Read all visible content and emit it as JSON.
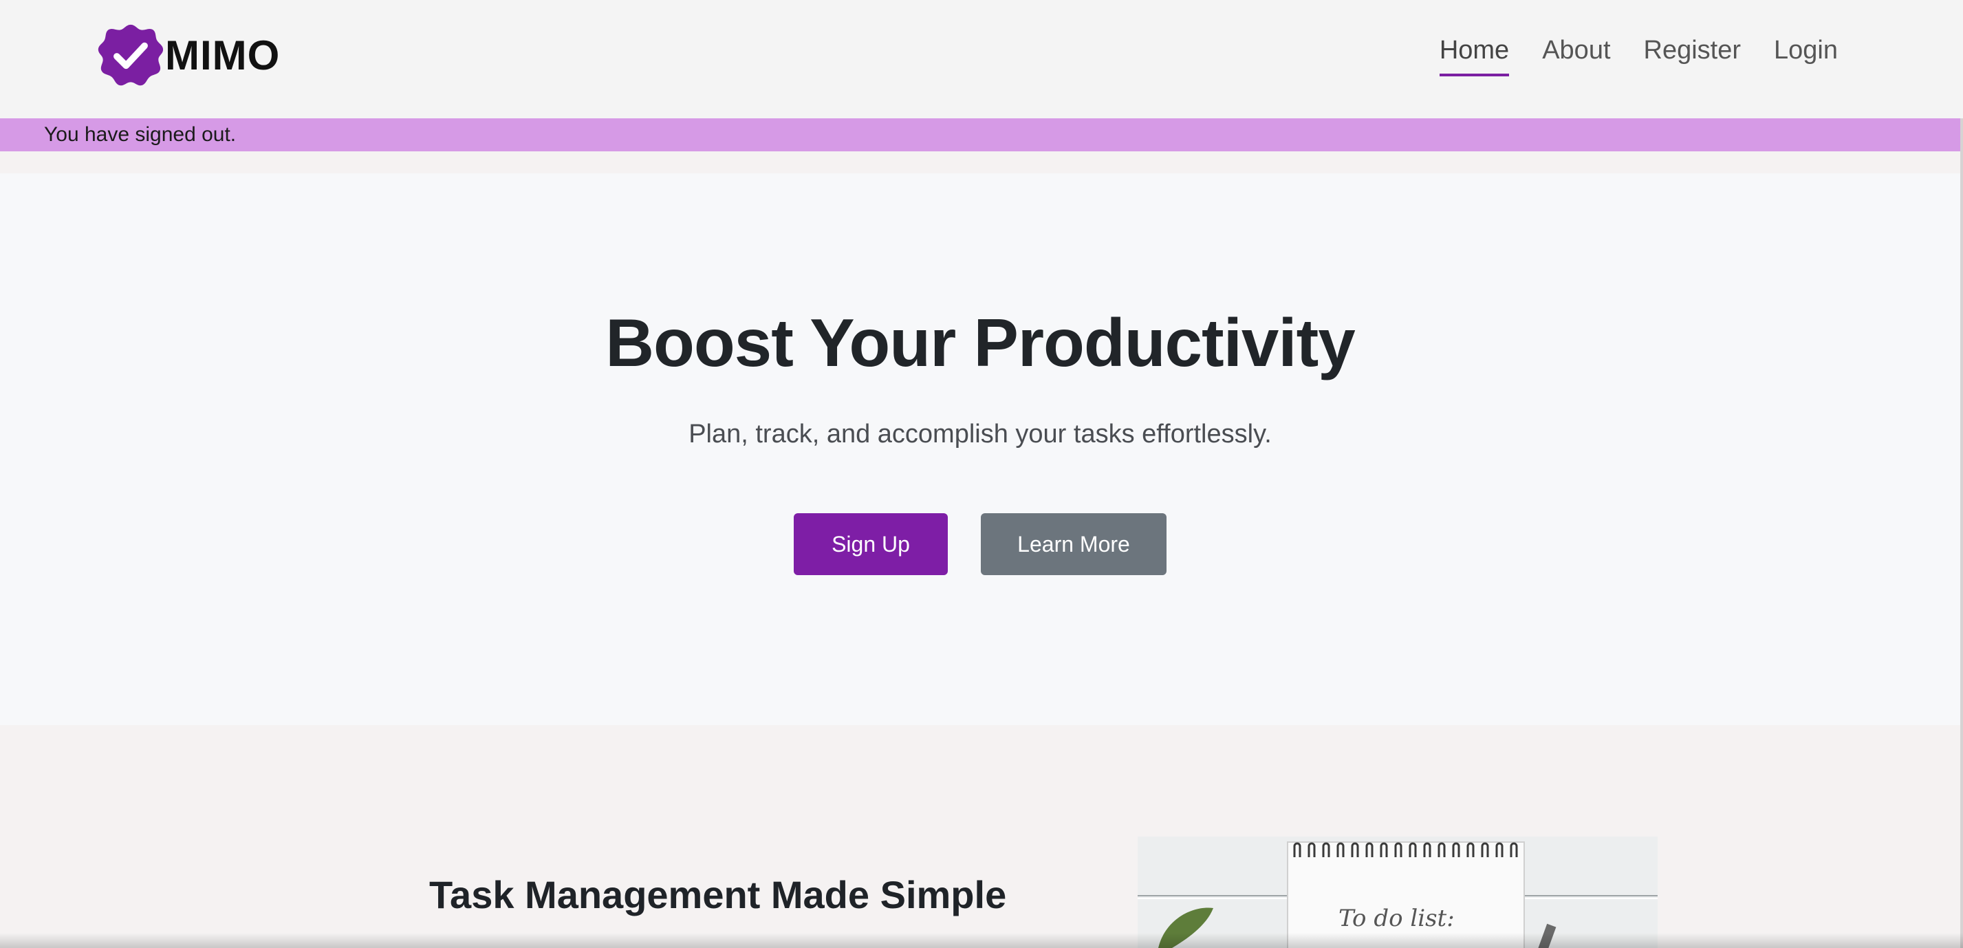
{
  "brand": {
    "name": "MIMO",
    "logo_icon": "check-badge-icon",
    "color": "#7b1fa2"
  },
  "nav": {
    "items": [
      {
        "label": "Home",
        "active": true
      },
      {
        "label": "About",
        "active": false
      },
      {
        "label": "Register",
        "active": false
      },
      {
        "label": "Login",
        "active": false
      }
    ]
  },
  "alert": {
    "message": "You have signed out.",
    "color": "#d69ae6"
  },
  "hero": {
    "title": "Boost Your Productivity",
    "subtitle": "Plan, track, and accomplish your tasks effortlessly.",
    "primary_button": "Sign Up",
    "secondary_button": "Learn More"
  },
  "feature": {
    "title": "Task Management Made Simple",
    "image_text": "To do list:"
  },
  "colors": {
    "accent": "#7e1ea6",
    "secondary": "#6c757d",
    "hero_bg": "#f7f8fa",
    "page_bg": "#f5f2f2"
  }
}
